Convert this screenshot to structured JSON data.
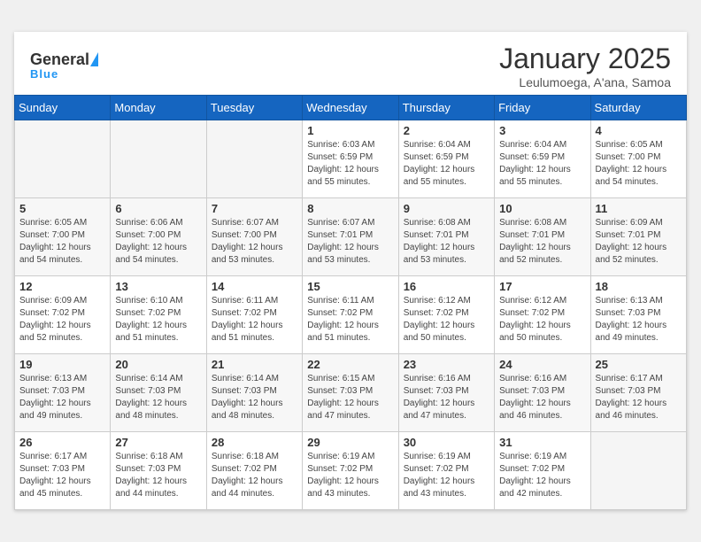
{
  "header": {
    "logo_general": "General",
    "logo_blue": "Blue",
    "month_title": "January 2025",
    "location": "Leulumoega, A'ana, Samoa"
  },
  "days_of_week": [
    "Sunday",
    "Monday",
    "Tuesday",
    "Wednesday",
    "Thursday",
    "Friday",
    "Saturday"
  ],
  "weeks": [
    [
      {
        "day": "",
        "info": ""
      },
      {
        "day": "",
        "info": ""
      },
      {
        "day": "",
        "info": ""
      },
      {
        "day": "1",
        "info": "Sunrise: 6:03 AM\nSunset: 6:59 PM\nDaylight: 12 hours\nand 55 minutes."
      },
      {
        "day": "2",
        "info": "Sunrise: 6:04 AM\nSunset: 6:59 PM\nDaylight: 12 hours\nand 55 minutes."
      },
      {
        "day": "3",
        "info": "Sunrise: 6:04 AM\nSunset: 6:59 PM\nDaylight: 12 hours\nand 55 minutes."
      },
      {
        "day": "4",
        "info": "Sunrise: 6:05 AM\nSunset: 7:00 PM\nDaylight: 12 hours\nand 54 minutes."
      }
    ],
    [
      {
        "day": "5",
        "info": "Sunrise: 6:05 AM\nSunset: 7:00 PM\nDaylight: 12 hours\nand 54 minutes."
      },
      {
        "day": "6",
        "info": "Sunrise: 6:06 AM\nSunset: 7:00 PM\nDaylight: 12 hours\nand 54 minutes."
      },
      {
        "day": "7",
        "info": "Sunrise: 6:07 AM\nSunset: 7:00 PM\nDaylight: 12 hours\nand 53 minutes."
      },
      {
        "day": "8",
        "info": "Sunrise: 6:07 AM\nSunset: 7:01 PM\nDaylight: 12 hours\nand 53 minutes."
      },
      {
        "day": "9",
        "info": "Sunrise: 6:08 AM\nSunset: 7:01 PM\nDaylight: 12 hours\nand 53 minutes."
      },
      {
        "day": "10",
        "info": "Sunrise: 6:08 AM\nSunset: 7:01 PM\nDaylight: 12 hours\nand 52 minutes."
      },
      {
        "day": "11",
        "info": "Sunrise: 6:09 AM\nSunset: 7:01 PM\nDaylight: 12 hours\nand 52 minutes."
      }
    ],
    [
      {
        "day": "12",
        "info": "Sunrise: 6:09 AM\nSunset: 7:02 PM\nDaylight: 12 hours\nand 52 minutes."
      },
      {
        "day": "13",
        "info": "Sunrise: 6:10 AM\nSunset: 7:02 PM\nDaylight: 12 hours\nand 51 minutes."
      },
      {
        "day": "14",
        "info": "Sunrise: 6:11 AM\nSunset: 7:02 PM\nDaylight: 12 hours\nand 51 minutes."
      },
      {
        "day": "15",
        "info": "Sunrise: 6:11 AM\nSunset: 7:02 PM\nDaylight: 12 hours\nand 51 minutes."
      },
      {
        "day": "16",
        "info": "Sunrise: 6:12 AM\nSunset: 7:02 PM\nDaylight: 12 hours\nand 50 minutes."
      },
      {
        "day": "17",
        "info": "Sunrise: 6:12 AM\nSunset: 7:02 PM\nDaylight: 12 hours\nand 50 minutes."
      },
      {
        "day": "18",
        "info": "Sunrise: 6:13 AM\nSunset: 7:03 PM\nDaylight: 12 hours\nand 49 minutes."
      }
    ],
    [
      {
        "day": "19",
        "info": "Sunrise: 6:13 AM\nSunset: 7:03 PM\nDaylight: 12 hours\nand 49 minutes."
      },
      {
        "day": "20",
        "info": "Sunrise: 6:14 AM\nSunset: 7:03 PM\nDaylight: 12 hours\nand 48 minutes."
      },
      {
        "day": "21",
        "info": "Sunrise: 6:14 AM\nSunset: 7:03 PM\nDaylight: 12 hours\nand 48 minutes."
      },
      {
        "day": "22",
        "info": "Sunrise: 6:15 AM\nSunset: 7:03 PM\nDaylight: 12 hours\nand 47 minutes."
      },
      {
        "day": "23",
        "info": "Sunrise: 6:16 AM\nSunset: 7:03 PM\nDaylight: 12 hours\nand 47 minutes."
      },
      {
        "day": "24",
        "info": "Sunrise: 6:16 AM\nSunset: 7:03 PM\nDaylight: 12 hours\nand 46 minutes."
      },
      {
        "day": "25",
        "info": "Sunrise: 6:17 AM\nSunset: 7:03 PM\nDaylight: 12 hours\nand 46 minutes."
      }
    ],
    [
      {
        "day": "26",
        "info": "Sunrise: 6:17 AM\nSunset: 7:03 PM\nDaylight: 12 hours\nand 45 minutes."
      },
      {
        "day": "27",
        "info": "Sunrise: 6:18 AM\nSunset: 7:03 PM\nDaylight: 12 hours\nand 44 minutes."
      },
      {
        "day": "28",
        "info": "Sunrise: 6:18 AM\nSunset: 7:02 PM\nDaylight: 12 hours\nand 44 minutes."
      },
      {
        "day": "29",
        "info": "Sunrise: 6:19 AM\nSunset: 7:02 PM\nDaylight: 12 hours\nand 43 minutes."
      },
      {
        "day": "30",
        "info": "Sunrise: 6:19 AM\nSunset: 7:02 PM\nDaylight: 12 hours\nand 43 minutes."
      },
      {
        "day": "31",
        "info": "Sunrise: 6:19 AM\nSunset: 7:02 PM\nDaylight: 12 hours\nand 42 minutes."
      },
      {
        "day": "",
        "info": ""
      }
    ]
  ]
}
